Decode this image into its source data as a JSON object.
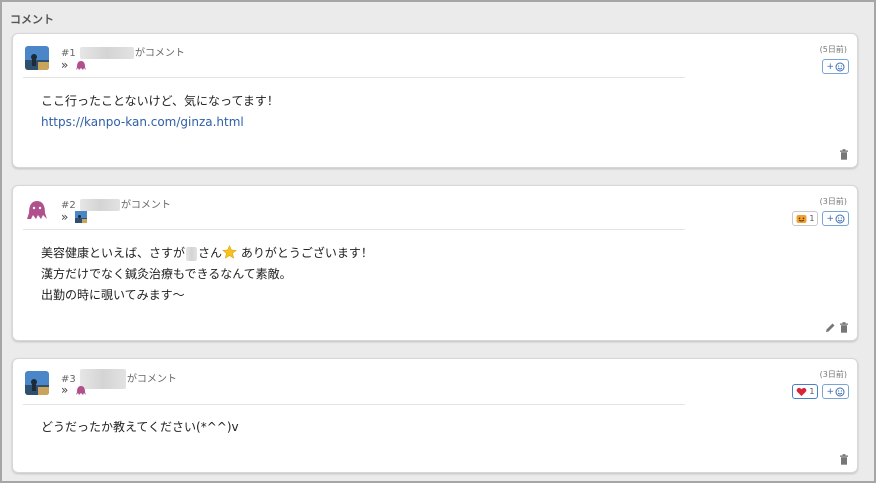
{
  "section": {
    "title": "コメント"
  },
  "comments": [
    {
      "number": "#1",
      "suffix": "がコメント",
      "reply_prefix": "»",
      "time": "(5日前)",
      "add_label": "+",
      "lines": [
        "ここ行ったことないけど、気になってます！"
      ],
      "link": "https://kanpo-kan.com/ginza.html",
      "avatar": "photo-avatar",
      "reply_avatar": "octopus-avatar",
      "reactions": [],
      "tools": [
        "trash-icon"
      ]
    },
    {
      "number": "#2",
      "suffix": "がコメント",
      "reply_prefix": "»",
      "time": "(3日前)",
      "add_label": "+",
      "line1_before": "美容健康といえば、さすが",
      "line1_after": "さん",
      "line1_end": " ありがとうございます！",
      "lines": [
        "漢方だけでなく鍼灸治療もできるなんて素敵。",
        "出勤の時に覗いてみます〜"
      ],
      "avatar": "octopus-avatar",
      "reply_avatar": "photo-avatar",
      "reactions": [
        {
          "icon": "smile-stamp-icon",
          "count": "1",
          "color": "#f0a030"
        }
      ],
      "tools": [
        "pencil-icon",
        "trash-icon"
      ]
    },
    {
      "number": "#3",
      "suffix": "がコメント",
      "reply_prefix": "»",
      "time": "(3日前)",
      "add_label": "+",
      "lines": [
        "どうだったか教えてください(*^^)v"
      ],
      "avatar": "photo-avatar",
      "reply_avatar": "octopus-avatar",
      "reactions": [
        {
          "icon": "heart-stamp-icon",
          "count": "1",
          "color": "#d9253a"
        }
      ],
      "tools": [
        "trash-icon"
      ]
    }
  ],
  "colors": {
    "link": "#2f5fa8",
    "accent": "#3b6db5",
    "octopus": "#b0508c"
  }
}
